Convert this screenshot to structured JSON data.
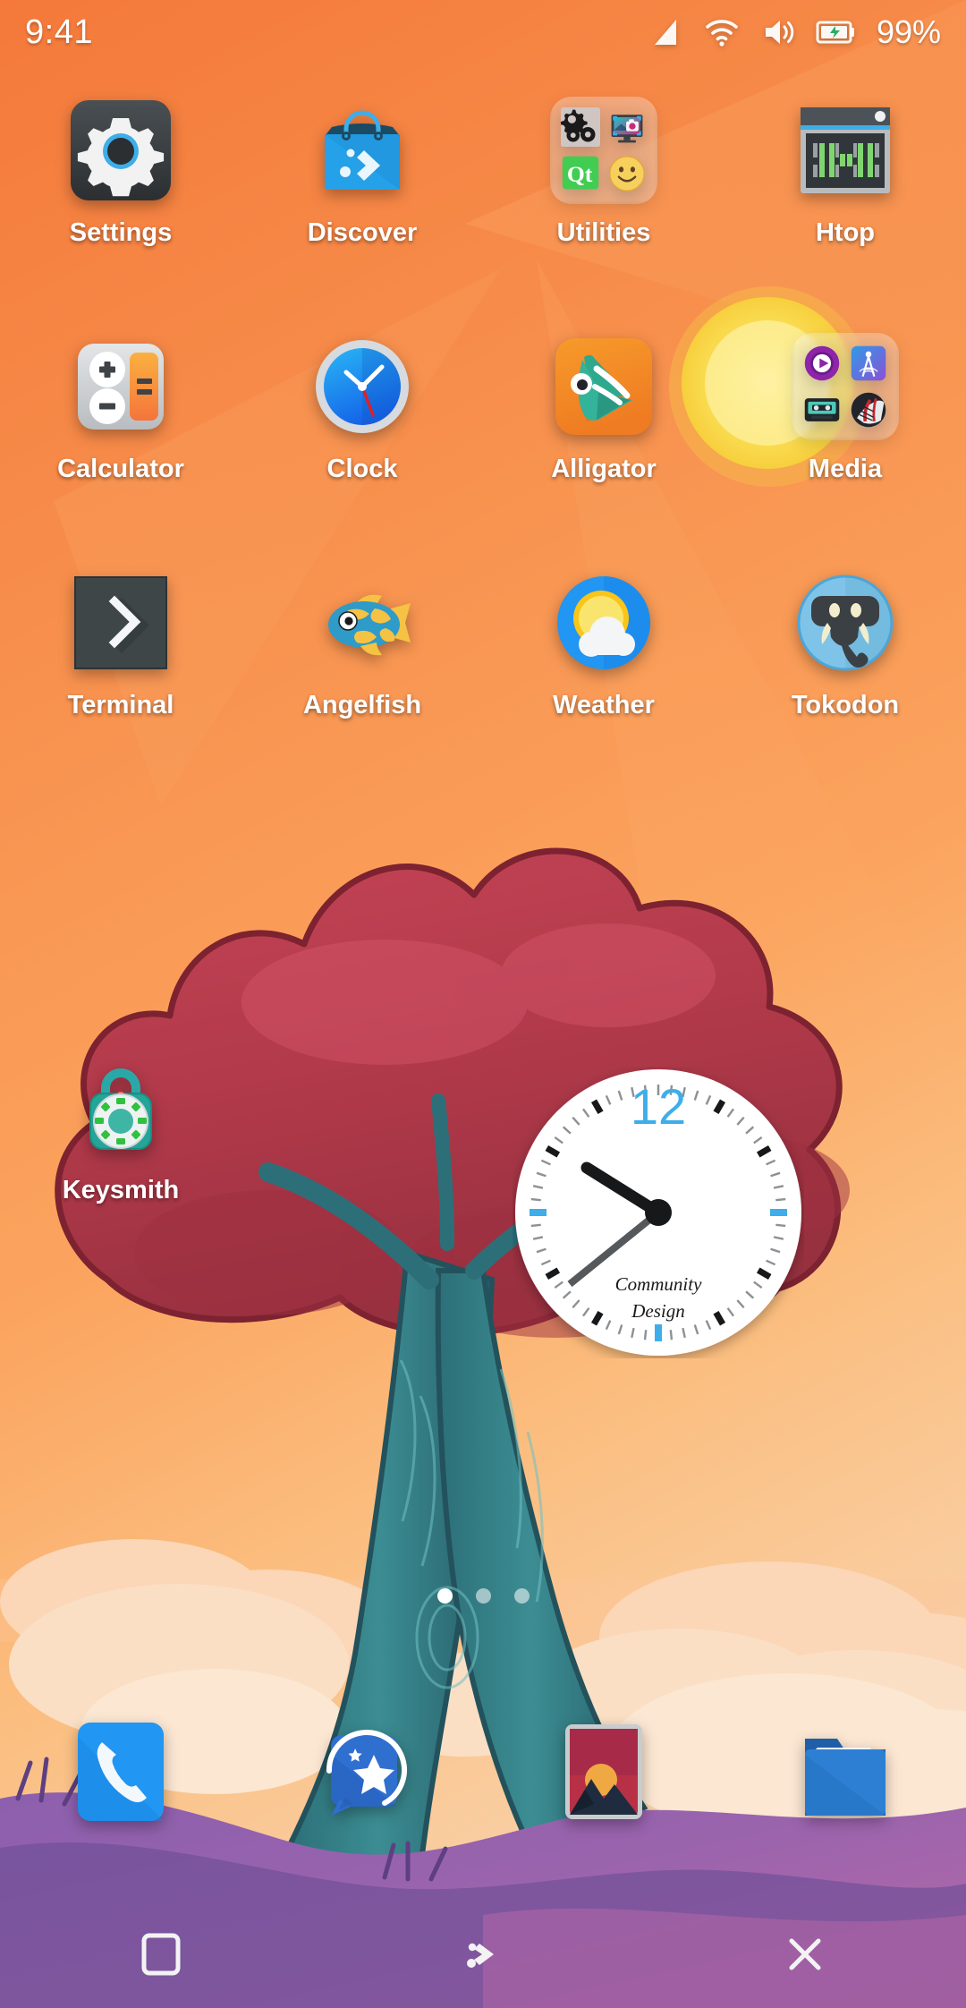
{
  "statusbar": {
    "time": "9:41",
    "battery_percent": "99%",
    "icons": [
      "cell-signal-icon",
      "wifi-icon",
      "volume-icon",
      "battery-icon"
    ]
  },
  "home": {
    "apps": [
      {
        "label": "Settings",
        "icon": "settings-gear-icon",
        "type": "app"
      },
      {
        "label": "Discover",
        "icon": "discover-bag-icon",
        "type": "app"
      },
      {
        "label": "Utilities",
        "icon": "folder-icon",
        "type": "folder",
        "contents": [
          "system-settings-gears-icon",
          "spectacle-screenshot-icon",
          "qt-logo-icon",
          "smiley-face-icon"
        ]
      },
      {
        "label": "Htop",
        "icon": "htop-terminal-icon",
        "type": "app"
      },
      {
        "label": "Calculator",
        "icon": "calculator-icon",
        "type": "app"
      },
      {
        "label": "Clock",
        "icon": "clock-face-icon",
        "type": "app"
      },
      {
        "label": "Alligator",
        "icon": "alligator-icon",
        "type": "app"
      },
      {
        "label": "Media",
        "icon": "folder-icon",
        "type": "folder",
        "contents": [
          "media-player-icon",
          "radio-tower-icon",
          "cassette-tape-icon",
          "vinyl-record-icon"
        ]
      },
      {
        "label": "Terminal",
        "icon": "terminal-prompt-icon",
        "type": "app"
      },
      {
        "label": "Angelfish",
        "icon": "angelfish-icon",
        "type": "app"
      },
      {
        "label": "Weather",
        "icon": "weather-sun-cloud-icon",
        "type": "app"
      },
      {
        "label": "Tokodon",
        "icon": "tokodon-elephant-icon",
        "type": "app"
      }
    ],
    "apps_row4": [
      {
        "label": "Keysmith",
        "icon": "keysmith-padlock-icon",
        "type": "app"
      }
    ]
  },
  "clock_widget": {
    "hour_number": "12",
    "brand_line1": "Community",
    "brand_line2": "Design",
    "hour_hand_angle": -55,
    "minute_hand_angle": 232
  },
  "pager": {
    "pages": 3,
    "active_index": 0
  },
  "dock": {
    "items": [
      {
        "label": "Phone",
        "icon": "phone-handset-icon"
      },
      {
        "label": "Contacts",
        "icon": "contacts-star-icon"
      },
      {
        "label": "Gallery",
        "icon": "gallery-mountain-icon"
      },
      {
        "label": "Files",
        "icon": "files-folder-icon"
      }
    ]
  },
  "navbar": {
    "buttons": [
      {
        "label": "Overview",
        "icon": "square-overview-icon"
      },
      {
        "label": "App Drawer",
        "icon": "plasma-logo-icon"
      },
      {
        "label": "Close",
        "icon": "close-x-icon"
      }
    ]
  },
  "colors": {
    "wallpaper_sky_top": "#f2813f",
    "wallpaper_sky_mid": "#f79b56",
    "accent_blue": "#3daee9",
    "sun_yellow": "#f7e04f",
    "tree_red": "#b5394b",
    "trunk_teal": "#2e7e84",
    "ground_purple": "#7e5ba6",
    "cloud_peach": "#f9d3b4"
  }
}
